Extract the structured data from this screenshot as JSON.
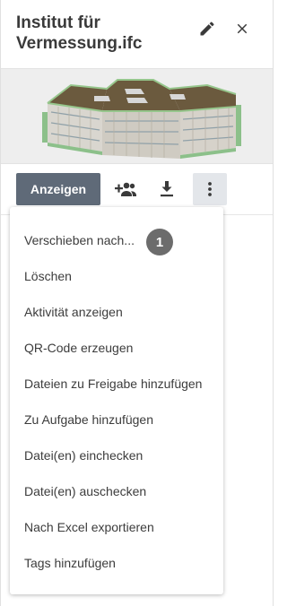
{
  "header": {
    "title_line1": "Institut für",
    "title_line2": "Vermessung.ifc"
  },
  "toolbar": {
    "primary_label": "Anzeigen"
  },
  "menu": {
    "items": [
      {
        "label": "Verschieben nach..."
      },
      {
        "label": "Löschen"
      },
      {
        "label": "Aktivität anzeigen"
      },
      {
        "label": "QR-Code erzeugen"
      },
      {
        "label": "Dateien zu Freigabe hinzufügen"
      },
      {
        "label": "Zu Aufgabe hinzufügen"
      },
      {
        "label": "Datei(en) einchecken"
      },
      {
        "label": "Datei(en) auschecken"
      },
      {
        "label": "Nach Excel exportieren"
      },
      {
        "label": "Tags hinzufügen"
      }
    ],
    "badge": "1"
  },
  "icons": {
    "edit": "pencil-icon",
    "close": "close-icon",
    "share": "add-people-icon",
    "download": "download-icon",
    "more": "more-vertical-icon"
  },
  "colors": {
    "primary_button": "#5f6a78",
    "badge": "#6c6c6c"
  }
}
